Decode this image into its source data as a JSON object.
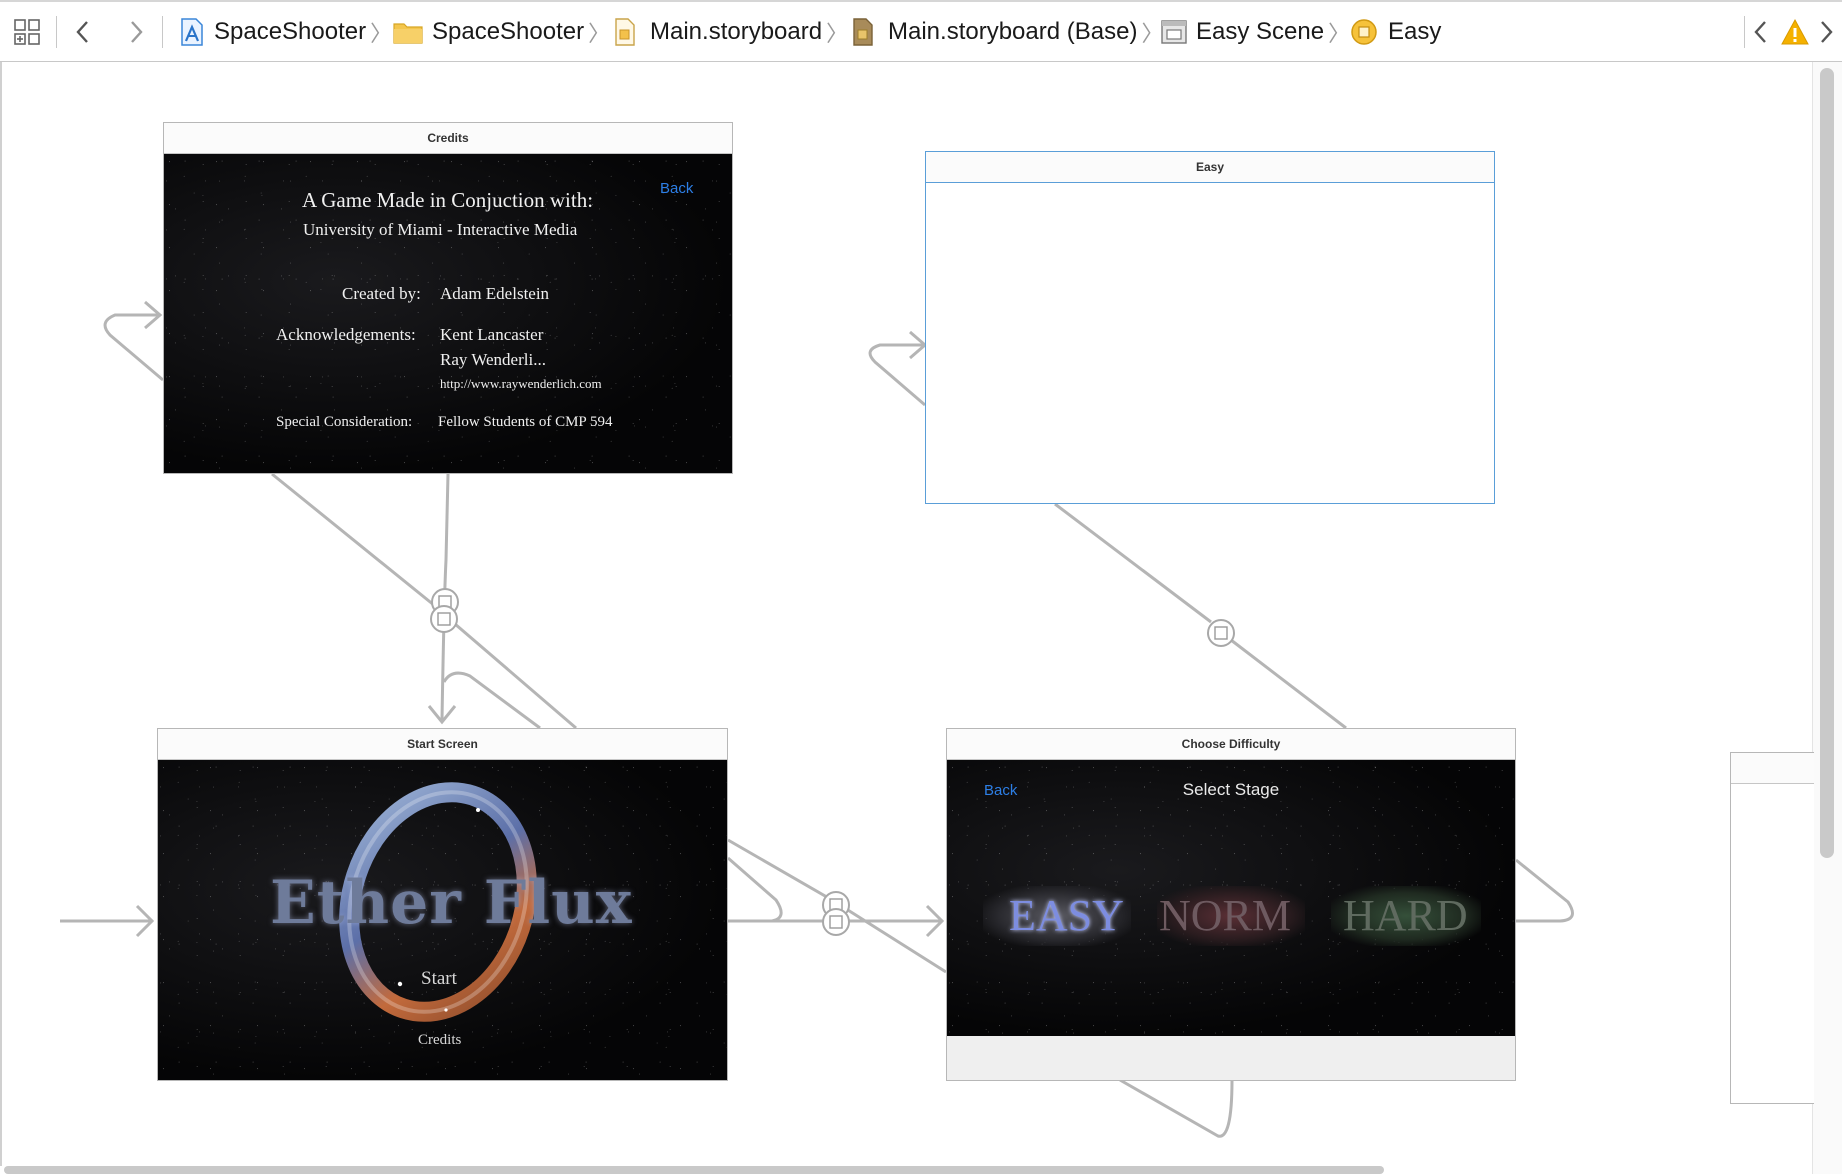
{
  "jumpbar": {
    "crumbs": [
      {
        "label": "SpaceShooter",
        "icon": "xcode-project-icon"
      },
      {
        "label": "SpaceShooter",
        "icon": "folder-icon"
      },
      {
        "label": "Main.storyboard",
        "icon": "storyboard-file-icon"
      },
      {
        "label": "Main.storyboard (Base)",
        "icon": "storyboard-base-icon"
      },
      {
        "label": "Easy Scene",
        "icon": "scene-icon"
      },
      {
        "label": "Easy",
        "icon": "view-controller-icon"
      }
    ]
  },
  "scenes": {
    "credits": {
      "title": "Credits",
      "back": "Back",
      "heading": "A Game Made in Conjuction with:",
      "subheading": "University of Miami - Interactive Media",
      "created_label": "Created by:",
      "created_value": "Adam Edelstein",
      "ack_label": "Acknowledgements:",
      "ack_1": "Kent Lancaster",
      "ack_2": "Ray Wenderli...",
      "ack_url": "http://www.raywenderlich.com",
      "special_label": "Special Consideration:",
      "special_value": "Fellow Students of CMP 594"
    },
    "easy": {
      "title": "Easy"
    },
    "start": {
      "title": "Start Screen",
      "logo": "Ether Flux",
      "start": "Start",
      "credits": "Credits"
    },
    "difficulty": {
      "title": "Choose Difficulty",
      "back": "Back",
      "header": "Select Stage",
      "easy": "EASY",
      "norm": "NORM",
      "hard": "HARD"
    }
  },
  "colors": {
    "accent": "#2d7fe6",
    "selected_border": "#5a9ed8",
    "warning": "#f5b100",
    "segue": "#b5b5b5"
  }
}
